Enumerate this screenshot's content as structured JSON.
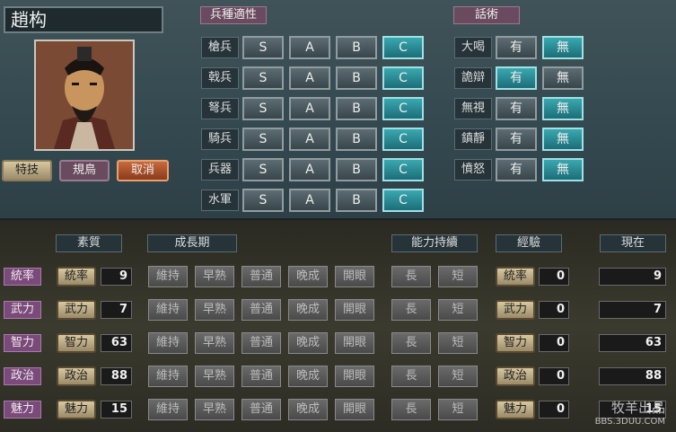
{
  "officer": {
    "name": "趙构"
  },
  "troop_aptitude": {
    "header": "兵種適性",
    "grades": [
      "S",
      "A",
      "B",
      "C"
    ],
    "rows": [
      {
        "label": "槍兵",
        "selected": "C"
      },
      {
        "label": "戟兵",
        "selected": "C"
      },
      {
        "label": "弩兵",
        "selected": "C"
      },
      {
        "label": "騎兵",
        "selected": "C"
      },
      {
        "label": "兵器",
        "selected": "C"
      },
      {
        "label": "水軍",
        "selected": "C"
      }
    ]
  },
  "debate": {
    "header": "話術",
    "yes": "有",
    "no": "無",
    "rows": [
      {
        "label": "大喝",
        "selected": "無"
      },
      {
        "label": "詭辯",
        "selected": "有"
      },
      {
        "label": "無視",
        "selected": "無"
      },
      {
        "label": "鎮靜",
        "selected": "無"
      },
      {
        "label": "憤怒",
        "selected": "無"
      }
    ]
  },
  "actions": {
    "skill": "特技",
    "skill_value": "規鳥",
    "cancel": "取消"
  },
  "growth": {
    "headers": {
      "aptitude": "素質",
      "growth": "成長期",
      "duration": "能力持續",
      "exp": "經驗",
      "current": "現在"
    },
    "growth_options": [
      "維持",
      "早熟",
      "普通",
      "晚成",
      "開眼"
    ],
    "duration_options": [
      "長",
      "短"
    ],
    "rows": [
      {
        "label": "統率",
        "base": "9",
        "exp": "0",
        "current": "9"
      },
      {
        "label": "武力",
        "base": "7",
        "exp": "0",
        "current": "7"
      },
      {
        "label": "智力",
        "base": "63",
        "exp": "0",
        "current": "63"
      },
      {
        "label": "政治",
        "base": "88",
        "exp": "0",
        "current": "88"
      },
      {
        "label": "魅力",
        "base": "15",
        "exp": "0",
        "current": "15"
      }
    ]
  },
  "watermark": {
    "line1": "牧羊出品",
    "line2": "BBS.3DUU.COM"
  }
}
